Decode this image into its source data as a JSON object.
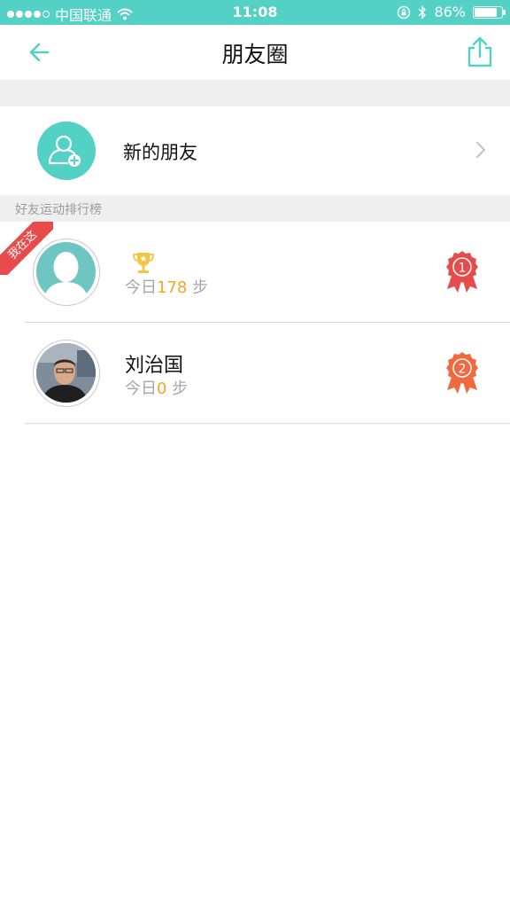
{
  "status_bar": {
    "carrier": "中国联通",
    "time": "11:08",
    "battery": "86%",
    "battery_level": 0.86
  },
  "nav": {
    "title": "朋友圈"
  },
  "new_friends": {
    "label": "新的朋友"
  },
  "section": {
    "title": "好友运动排行榜"
  },
  "ranking": {
    "me_badge": "我在这",
    "rows": [
      {
        "name": "",
        "steps_prefix": "今日",
        "steps": "178",
        "steps_suffix": " 步",
        "rank": 1
      },
      {
        "name": "刘治国",
        "steps_prefix": "今日",
        "steps": "0",
        "steps_suffix": " 步",
        "rank": 2
      }
    ]
  },
  "colors": {
    "accent": "#52d1c4",
    "steps_highlight": "#f5a623",
    "medal_1": "#e84b4b",
    "medal_2": "#ef6a3f",
    "ribbon": "#e84b4b"
  }
}
